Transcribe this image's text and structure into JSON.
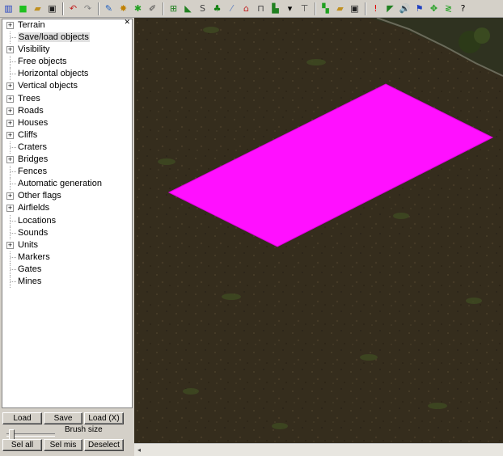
{
  "toolbar": {
    "icons": [
      {
        "name": "chart-icon",
        "glyph": "▥",
        "color": "#2040c0"
      },
      {
        "name": "new-map-icon",
        "glyph": "■",
        "color": "#20c020"
      },
      {
        "name": "open-folder-icon",
        "glyph": "▰",
        "color": "#c09020"
      },
      {
        "name": "save-disk-icon",
        "glyph": "▣",
        "color": "#202020"
      },
      {
        "sep": true
      },
      {
        "name": "undo-icon",
        "glyph": "↶",
        "color": "#c02020"
      },
      {
        "name": "redo-icon",
        "glyph": "↷",
        "color": "#808080"
      },
      {
        "sep": true
      },
      {
        "name": "paint-terrain-icon",
        "glyph": "✎",
        "color": "#2060c0"
      },
      {
        "name": "brush-icon",
        "glyph": "✸",
        "color": "#c08000"
      },
      {
        "name": "palette-icon",
        "glyph": "✱",
        "color": "#20a020"
      },
      {
        "name": "edit-icon",
        "glyph": "✐",
        "color": "#404040"
      },
      {
        "sep": true
      },
      {
        "name": "objects-icon",
        "glyph": "⊞",
        "color": "#208020"
      },
      {
        "name": "boot-icon",
        "glyph": "◣",
        "color": "#208020"
      },
      {
        "name": "sign-icon",
        "glyph": "S",
        "color": "#404040"
      },
      {
        "name": "tree-icon",
        "glyph": "♣",
        "color": "#108010"
      },
      {
        "name": "road-icon",
        "glyph": "⁄",
        "color": "#6080c0"
      },
      {
        "name": "house-icon",
        "glyph": "⌂",
        "color": "#c02020"
      },
      {
        "name": "fence-icon",
        "glyph": "⊓",
        "color": "#404040"
      },
      {
        "name": "cliff-icon",
        "glyph": "▙",
        "color": "#208020"
      },
      {
        "name": "dropdown-icon",
        "glyph": "▾",
        "color": "#000000"
      },
      {
        "name": "bridge-icon",
        "glyph": "⊤",
        "color": "#404040"
      },
      {
        "sep": true
      },
      {
        "name": "flag-icon",
        "glyph": "▚",
        "color": "#20a020"
      },
      {
        "name": "folder-icon",
        "glyph": "▰",
        "color": "#c09020"
      },
      {
        "name": "disk-icon",
        "glyph": "▣",
        "color": "#202020"
      },
      {
        "sep": true
      },
      {
        "name": "alert-icon",
        "glyph": "!",
        "color": "#e00000"
      },
      {
        "name": "unit-icon",
        "glyph": "◤",
        "color": "#208020"
      },
      {
        "name": "sound-icon",
        "glyph": "🔊",
        "color": "#404040"
      },
      {
        "name": "marker-icon",
        "glyph": "⚑",
        "color": "#2040c0"
      },
      {
        "name": "move-icon",
        "glyph": "✥",
        "color": "#20a020"
      },
      {
        "name": "wave-icon",
        "glyph": "≷",
        "color": "#20a020"
      },
      {
        "name": "help-icon",
        "glyph": "?",
        "color": "#000000"
      }
    ]
  },
  "tree": {
    "items": [
      {
        "label": "Terrain",
        "expandable": true,
        "selected": false
      },
      {
        "label": "Save/load objects",
        "expandable": false,
        "selected": true
      },
      {
        "label": "Visibility",
        "expandable": true,
        "selected": false
      },
      {
        "label": "Free objects",
        "expandable": false,
        "selected": false
      },
      {
        "label": "Horizontal objects",
        "expandable": false,
        "selected": false
      },
      {
        "label": "Vertical objects",
        "expandable": true,
        "selected": false
      },
      {
        "label": "Trees",
        "expandable": true,
        "selected": false
      },
      {
        "label": "Roads",
        "expandable": true,
        "selected": false
      },
      {
        "label": "Houses",
        "expandable": true,
        "selected": false
      },
      {
        "label": "Cliffs",
        "expandable": true,
        "selected": false
      },
      {
        "label": "Craters",
        "expandable": false,
        "selected": false
      },
      {
        "label": "Bridges",
        "expandable": true,
        "selected": false
      },
      {
        "label": "Fences",
        "expandable": false,
        "selected": false
      },
      {
        "label": "Automatic generation",
        "expandable": false,
        "selected": false
      },
      {
        "label": "Other flags",
        "expandable": true,
        "selected": false
      },
      {
        "label": "Airfields",
        "expandable": true,
        "selected": false
      },
      {
        "label": "Locations",
        "expandable": false,
        "selected": false
      },
      {
        "label": "Sounds",
        "expandable": false,
        "selected": false
      },
      {
        "label": "Units",
        "expandable": true,
        "selected": false
      },
      {
        "label": "Markers",
        "expandable": false,
        "selected": false
      },
      {
        "label": "Gates",
        "expandable": false,
        "selected": false
      },
      {
        "label": "Mines",
        "expandable": false,
        "selected": false
      }
    ]
  },
  "buttons": {
    "load": "Load",
    "save": "Save",
    "load_x": "Load (X)",
    "sel_all": "Sel all",
    "sel_mis": "Sel mis",
    "deselect": "Deselect"
  },
  "brush": {
    "label": "Brush size",
    "level": 0.05
  },
  "colors": {
    "selection": "#ff10ff",
    "ground": "#352d1d"
  }
}
